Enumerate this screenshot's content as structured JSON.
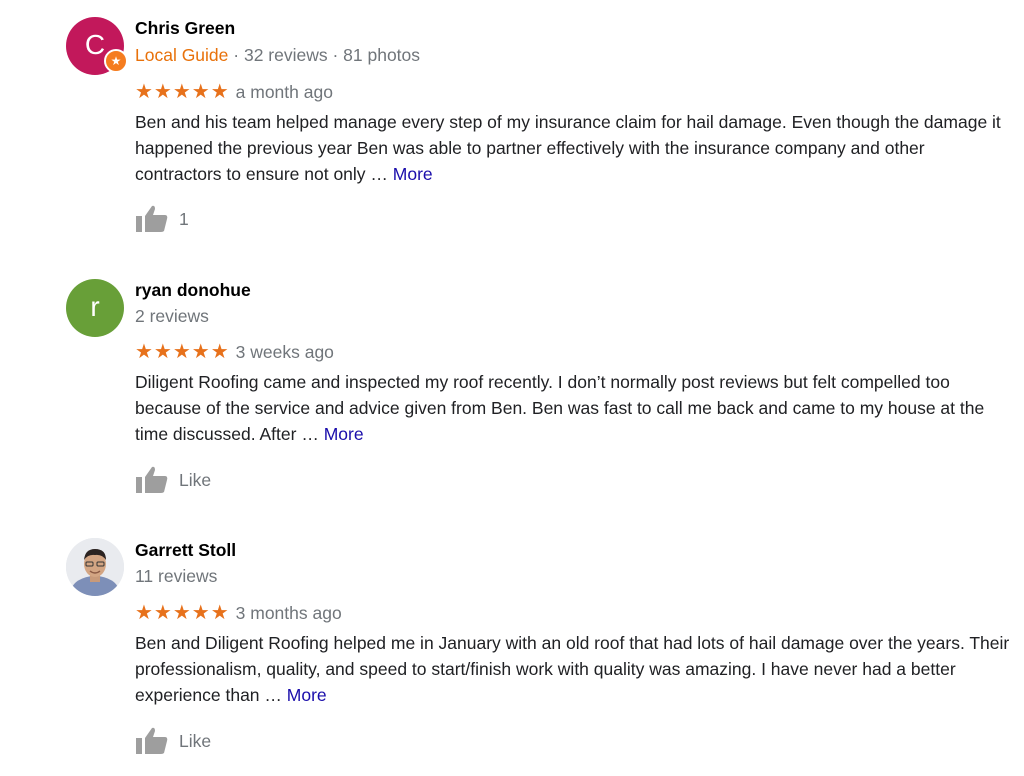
{
  "reviews": [
    {
      "name": "Chris Green",
      "avatar_letter": "C",
      "avatar_color": "#c2185b",
      "local_guide": "Local Guide",
      "meta_rest": " · 32 reviews · 81 photos",
      "stars": "★★★★★",
      "time": "a month ago",
      "text": "Ben and his team helped manage every step of my insurance claim for hail damage. Even though the damage it happened the previous year Ben was able to partner effectively with the insurance company and other contractors to ensure not only … ",
      "more": "More",
      "like": "1"
    },
    {
      "name": "ryan donohue",
      "avatar_letter": "r",
      "avatar_color": "#689f38",
      "meta": "2 reviews",
      "stars": "★★★★★",
      "time": "3 weeks ago",
      "text": "Diligent Roofing came and inspected my roof recently. I don’t normally post reviews but felt compelled too because of the service and advice given from Ben. Ben was fast to call me back and came to my house at the time discussed. After … ",
      "more": "More",
      "like": "Like"
    },
    {
      "name": "Garrett Stoll",
      "meta": "11 reviews",
      "stars": "★★★★★",
      "time": "3 months ago",
      "text": "Ben and Diligent Roofing helped me in January with an old roof that had lots of hail damage over the years. Their professionalism, quality, and speed to start/finish work with quality was amazing. I have never had a better experience than … ",
      "more": "More",
      "like": "Like"
    }
  ]
}
